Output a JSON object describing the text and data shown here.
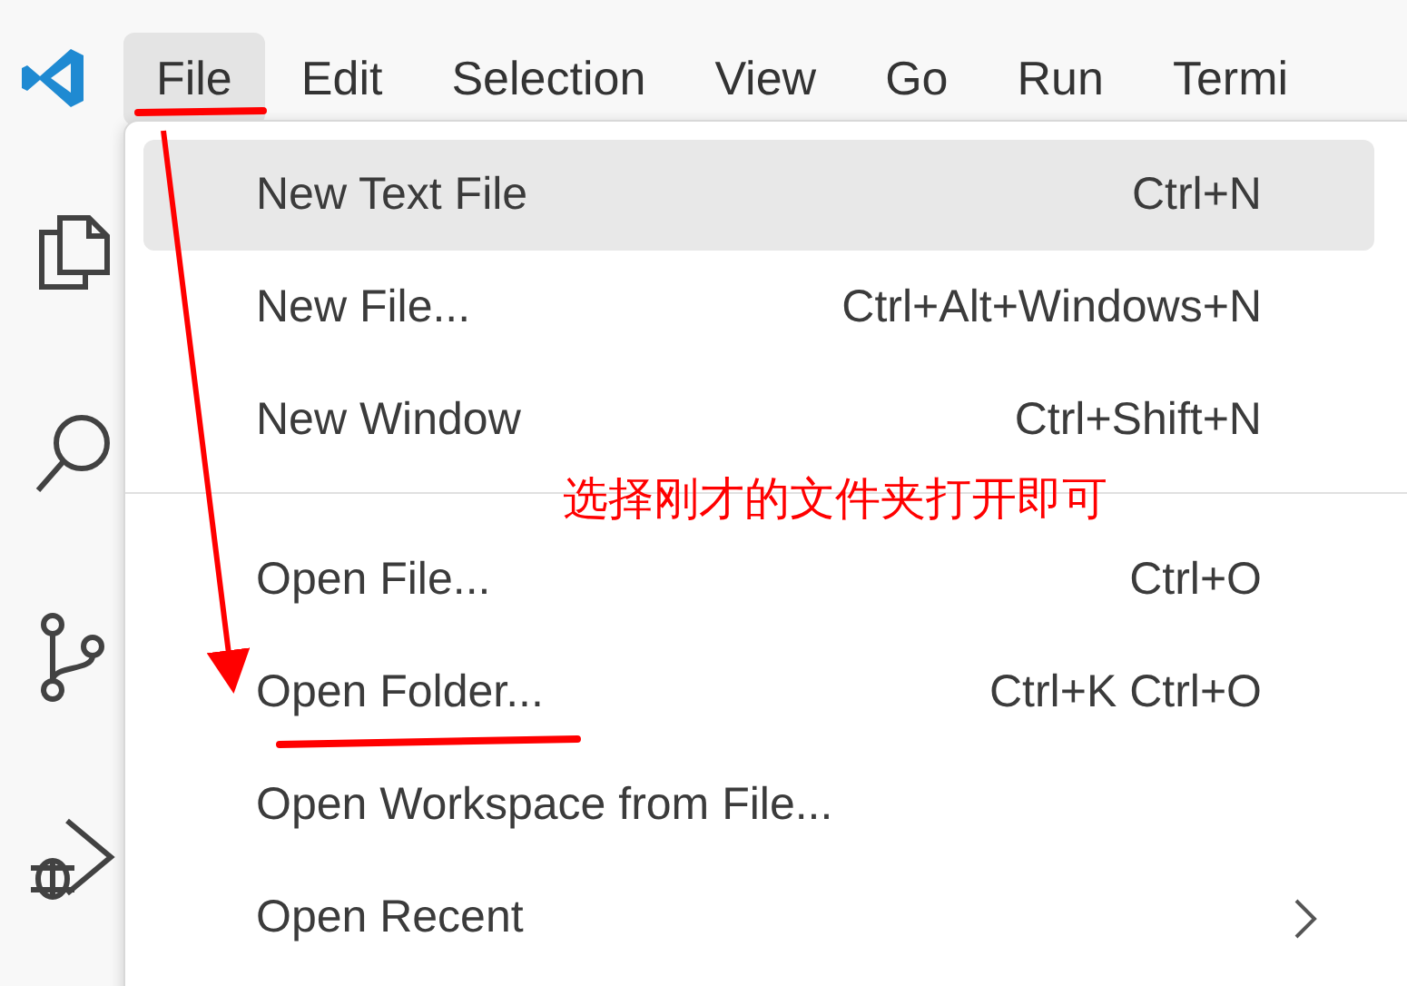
{
  "menubar": [
    {
      "label": "File",
      "selected": true
    },
    {
      "label": "Edit",
      "selected": false
    },
    {
      "label": "Selection",
      "selected": false
    },
    {
      "label": "View",
      "selected": false
    },
    {
      "label": "Go",
      "selected": false
    },
    {
      "label": "Run",
      "selected": false
    },
    {
      "label": "Termi",
      "selected": false
    }
  ],
  "file_menu": [
    {
      "kind": "item",
      "label": "New Text File",
      "shortcut": "Ctrl+N",
      "highlighted": true,
      "submenu": false
    },
    {
      "kind": "item",
      "label": "New File...",
      "shortcut": "Ctrl+Alt+Windows+N",
      "highlighted": false,
      "submenu": false
    },
    {
      "kind": "item",
      "label": "New Window",
      "shortcut": "Ctrl+Shift+N",
      "highlighted": false,
      "submenu": false
    },
    {
      "kind": "separator"
    },
    {
      "kind": "item",
      "label": "Open File...",
      "shortcut": "Ctrl+O",
      "highlighted": false,
      "submenu": false
    },
    {
      "kind": "item",
      "label": "Open Folder...",
      "shortcut": "Ctrl+K Ctrl+O",
      "highlighted": false,
      "submenu": false
    },
    {
      "kind": "item",
      "label": "Open Workspace from File...",
      "highlighted": false,
      "submenu": false
    },
    {
      "kind": "item",
      "label": "Open Recent",
      "highlighted": false,
      "submenu": true
    }
  ],
  "annotation": {
    "note": "选择刚才的文件夹打开即可"
  }
}
